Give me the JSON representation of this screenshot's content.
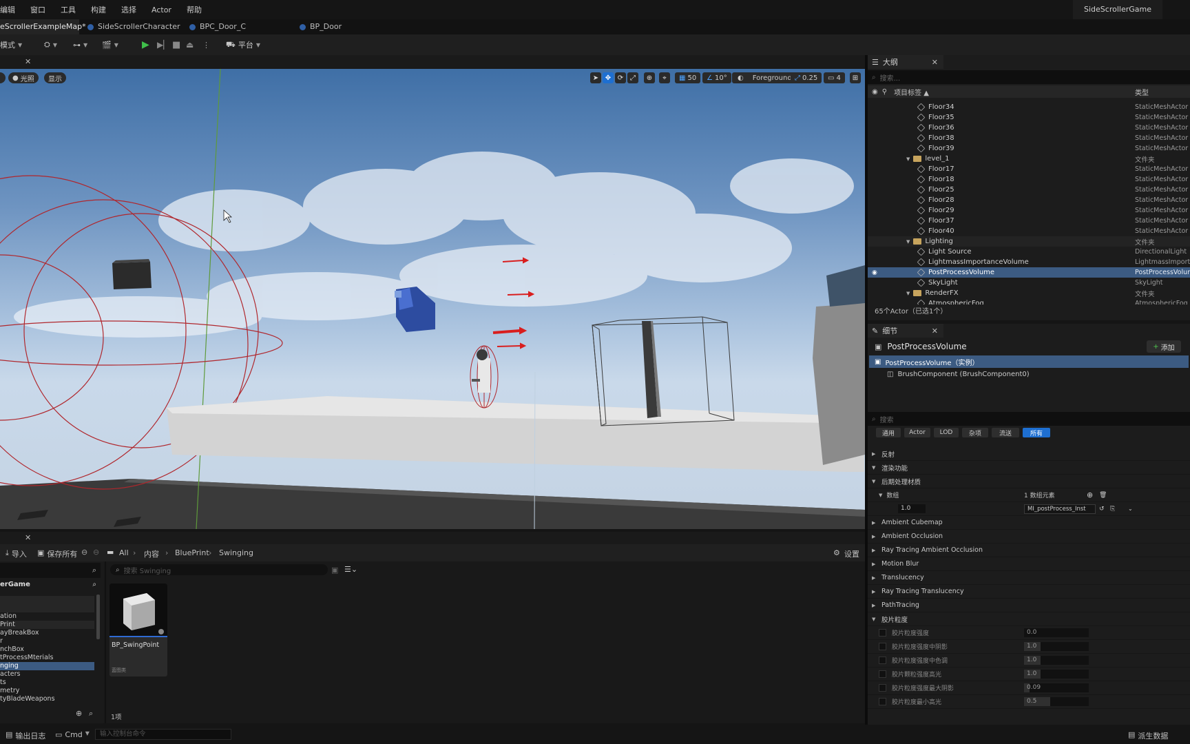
{
  "menu": [
    "编辑",
    "窗口",
    "工具",
    "构建",
    "选择",
    "Actor",
    "帮助"
  ],
  "project_name": "SideScrollerGame",
  "tabs": [
    {
      "label": "eScrollerExampleMap*"
    },
    {
      "label": "SideScrollerCharacter"
    },
    {
      "label": "BPC_Door_C"
    },
    {
      "label": "BP_Door"
    }
  ],
  "toolbar": {
    "mode": "模式",
    "platform": "平台"
  },
  "viewport": {
    "lighting": "光照",
    "show": "显示",
    "foreground": "Foreground",
    "grid_snap": "50",
    "rot_snap": "10°",
    "scale_snap": "0.25",
    "camera_speed": "4"
  },
  "outliner": {
    "title": "大纲",
    "search_placeholder": "搜索...",
    "col_label": "项目标签 ▲",
    "col_type": "类型",
    "rows": [
      {
        "name": "Floor34",
        "type": "StaticMeshActor",
        "kind": "mesh"
      },
      {
        "name": "Floor35",
        "type": "StaticMeshActor",
        "kind": "mesh"
      },
      {
        "name": "Floor36",
        "type": "StaticMeshActor",
        "kind": "mesh"
      },
      {
        "name": "Floor38",
        "type": "StaticMeshActor",
        "kind": "mesh"
      },
      {
        "name": "Floor39",
        "type": "StaticMeshActor",
        "kind": "mesh"
      },
      {
        "name": "level_1",
        "type": "文件夹",
        "kind": "folder"
      },
      {
        "name": "Floor17",
        "type": "StaticMeshActor",
        "kind": "mesh"
      },
      {
        "name": "Floor18",
        "type": "StaticMeshActor",
        "kind": "mesh"
      },
      {
        "name": "Floor25",
        "type": "StaticMeshActor",
        "kind": "mesh"
      },
      {
        "name": "Floor28",
        "type": "StaticMeshActor",
        "kind": "mesh"
      },
      {
        "name": "Floor29",
        "type": "StaticMeshActor",
        "kind": "mesh"
      },
      {
        "name": "Floor37",
        "type": "StaticMeshActor",
        "kind": "mesh"
      },
      {
        "name": "Floor40",
        "type": "StaticMeshActor",
        "kind": "mesh"
      },
      {
        "name": "Lighting",
        "type": "文件夹",
        "kind": "folder"
      },
      {
        "name": "Light Source",
        "type": "DirectionalLight",
        "kind": "light"
      },
      {
        "name": "LightmassImportanceVolume",
        "type": "LightmassImportanceVolume",
        "kind": "mesh"
      },
      {
        "name": "PostProcessVolume",
        "type": "PostProcessVolume",
        "kind": "mesh"
      },
      {
        "name": "SkyLight",
        "type": "SkyLight",
        "kind": "light"
      },
      {
        "name": "RenderFX",
        "type": "文件夹",
        "kind": "folder"
      },
      {
        "name": "AtmosphericFog",
        "type": "AtmosphericFog",
        "kind": "light"
      }
    ],
    "footer": "65个Actor（已选1个）"
  },
  "details": {
    "title": "细节",
    "object_name": "PostProcessVolume",
    "add_label": "添加",
    "instance_label": "PostProcessVolume（实例）",
    "component_label": "BrushComponent (BrushComponent0)",
    "search_placeholder": "搜索",
    "filters": [
      "通用",
      "Actor",
      "LOD",
      "杂项",
      "流送",
      "所有"
    ],
    "cat_reflection": "反射",
    "cat_rendering": "渲染功能",
    "cat_ppm": "后期处理材质",
    "array_label": "数组",
    "array_count": "1 数组元素",
    "weight_value": "1.0",
    "material_value": "MI_postProcess_Inst",
    "categories2": [
      "Ambient Cubemap",
      "Ambient Occlusion",
      "Ray Tracing Ambient Occlusion",
      "Motion Blur",
      "Translucency",
      "Ray Tracing Translucency",
      "PathTracing"
    ],
    "cat_grain": "胶片粒度",
    "grain_rows": [
      {
        "label": "胶片粒度强度",
        "value": "0.0",
        "fill": 0.0
      },
      {
        "label": "胶片粒度强度中阴影",
        "value": "1.0",
        "fill": 0.25
      },
      {
        "label": "胶片粒度强度中色调",
        "value": "1.0",
        "fill": 0.25
      },
      {
        "label": "胶片颗粒强度高光",
        "value": "1.0",
        "fill": 0.25
      },
      {
        "label": "胶片粒度强度最大阴影",
        "value": "0.09",
        "fill": 0.08
      },
      {
        "label": "胶片粒度最小高光",
        "value": "0.5",
        "fill": 0.4
      }
    ]
  },
  "content": {
    "import": "导入",
    "save_all": "保存所有",
    "breadcrumb": [
      "All",
      "内容",
      "BluePrint",
      "Swinging"
    ],
    "settings": "设置",
    "search_placeholder": "搜索 Swinging",
    "root": "erGame",
    "folders": [
      "",
      "ation",
      "Print",
      "ayBreakBox",
      "r",
      "nchBox",
      "tProcessMterials",
      "nging",
      "acters",
      "ts",
      "metry",
      "tyBladeWeapons"
    ],
    "asset_name": "BP_SwingPoint",
    "asset_type": "蓝图类",
    "count": "1项"
  },
  "status": {
    "output_log": "输出日志",
    "cmd": "Cmd",
    "console_placeholder": "输入控制台命令",
    "derived_data": "派生数据"
  }
}
